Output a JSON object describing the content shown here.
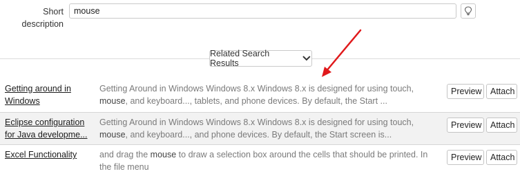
{
  "form": {
    "label_line1": "Short",
    "label_line2": "description",
    "value": "mouse",
    "hint_icon": "lightbulb-icon"
  },
  "related": {
    "label": "Related Search Results",
    "icon": "chevron-down-icon"
  },
  "annotation": {
    "arrow_color": "#e0191b"
  },
  "results": [
    {
      "title": "Getting around in Windows",
      "snippet_pre": "Getting Around in Windows Windows 8.x Windows 8.x is designed for using touch,",
      "snippet_bold": "mouse",
      "snippet_post": ", and keyboard..., tablets, and phone devices. By default, the Start ...",
      "preview": "Preview",
      "attach": "Attach"
    },
    {
      "title": "Eclipse configuration for Java developme...",
      "snippet_pre": "Getting Around in Windows Windows 8.x Windows 8.x is designed for using touch,",
      "snippet_bold": "mouse",
      "snippet_post": ", and keyboard..., and phone devices. By default, the Start screen is...",
      "preview": "Preview",
      "attach": "Attach"
    },
    {
      "title": "Excel Functionality",
      "snippet_pre": "and drag the ",
      "snippet_bold": "mouse",
      "snippet_post": " to draw a selection box around the cells that should be printed. In the file menu",
      "preview": "Preview",
      "attach": "Attach"
    }
  ]
}
